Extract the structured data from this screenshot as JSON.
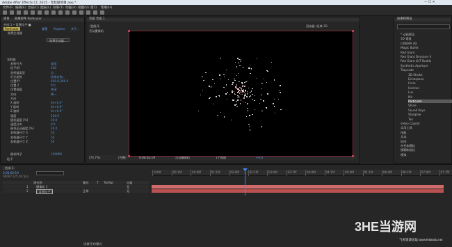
{
  "window": {
    "title": "Adobe After Effects CC 2015 - 无标题项目.aep *"
  },
  "menu": [
    "文件(F)",
    "编辑(E)",
    "合成(C)",
    "图层(L)",
    "效果(T)",
    "动画(A)",
    "视图(V)",
    "窗口",
    "帮助(H)"
  ],
  "left_panel": {
    "tabs": [
      "项目",
      "效果控件 Particular"
    ],
    "breadcrumb": "合成 1 • 背景粒子 ■",
    "effect_name": "Particular",
    "effect_links": [
      "重置",
      "Register",
      "关于..."
    ],
    "sub_label": "效果生成器",
    "button": "效果生成器...",
    "rows": [
      {
        "label": "发射器",
        "value": "",
        "indent": 1
      },
      {
        "label": "发射行为",
        "value": "连续",
        "indent": 2
      },
      {
        "label": "粒子/秒",
        "value": "100",
        "indent": 2
      },
      {
        "label": "发射器类型",
        "value": "点",
        "indent": 2
      },
      {
        "label": "灯光发射",
        "value": "选择名称...",
        "indent": 2
      },
      {
        "label": "位置XY",
        "value": "640.0,360.0",
        "indent": 2
      },
      {
        "label": "位置 Z",
        "value": "0.0",
        "indent": 2
      },
      {
        "label": "位置插值",
        "value": "关闭",
        "indent": 2
      },
      {
        "label": "方向",
        "value": "统一",
        "indent": 2
      },
      {
        "label": "方向",
        "value": "",
        "indent": 2
      },
      {
        "label": "X 旋转",
        "value": "0x+0.0°",
        "indent": 2
      },
      {
        "label": "Y 旋转",
        "value": "0x+0.0°",
        "indent": 2
      },
      {
        "label": "Z 旋转",
        "value": "0x+0.0°",
        "indent": 2
      },
      {
        "label": "速度",
        "value": "100.0",
        "indent": 2
      },
      {
        "label": "随机速度 [%]",
        "value": "20.0",
        "indent": 2
      },
      {
        "label": "速度分布",
        "value": "0.5",
        "indent": 2
      },
      {
        "label": "继承运动速度 [%]",
        "value": "20.0",
        "indent": 2
      },
      {
        "label": "发射器尺寸 X",
        "value": "50",
        "indent": 2
      },
      {
        "label": "发射器尺寸 Y",
        "value": "50",
        "indent": 2
      },
      {
        "label": "发射器尺寸 Z",
        "value": "50",
        "indent": 2
      },
      {
        "label": "",
        "value": "",
        "indent": 2
      },
      {
        "label": "",
        "value": "",
        "indent": 2
      },
      {
        "label": "随机种子",
        "value": "100000",
        "indent": 2
      },
      {
        "label": "粒子",
        "value": "",
        "indent": 1
      }
    ]
  },
  "viewer": {
    "tab": "合成 合成 1",
    "left_label": "合成 1",
    "caption": "活动摄像机",
    "renderer": "渲染器: 经典 3D",
    "bottom": [
      "(74.7%)",
      "(完整)",
      "0:00:02:19",
      "活动摄像机",
      "1个视图",
      "+0.0"
    ]
  },
  "right_panel": {
    "tab": "效果和预设",
    "search": "",
    "items": [
      "* 动画预设",
      "3D 通道",
      "CINEMA 4D",
      "Magic Bullet",
      "Red Giant",
      "Red Giant Denoiser II",
      "Red Giant LUT Buddy",
      "Synthetic Aperture",
      "Trapcode",
      "3D Stroke",
      "Echospace",
      "Form",
      "Horizon",
      "Lux",
      "Mir",
      "Particular",
      "Shine",
      "Sound Keys",
      "Starglow",
      "Tao",
      "Video Copilot",
      "实用工具",
      "扭曲",
      "文本",
      "时间",
      "杂色和颗粒",
      "模糊和锐化",
      "模拟"
    ]
  },
  "timeline": {
    "tab": "合成 1",
    "timecode": "0:00:02:19",
    "frame_info": "00067 (25.00 fps)",
    "columns": [
      "源名称",
      "模式",
      "T",
      "TrkMat",
      "父级"
    ],
    "layers": [
      {
        "index": "1",
        "name": "摄像机 1",
        "mode": "",
        "parent": "无"
      },
      {
        "index": "2",
        "name": "[背景粒子]",
        "mode": "正常",
        "parent": "无"
      }
    ],
    "ticks": [
      "0:00f",
      "00:15f",
      "01:00f",
      "01:15f",
      "02:00f",
      "02:15f",
      "03:00f",
      "03:15f",
      "04:00f",
      "04:15f",
      "05:00f",
      "05:15f",
      "06:00f",
      "06:15f",
      "07:00f",
      "07:15f"
    ],
    "bottom_label": "切换开关/模式"
  },
  "watermark": {
    "brand": "3HE当游网",
    "site": "飞天资源论坛 www.fetiandu.net"
  }
}
